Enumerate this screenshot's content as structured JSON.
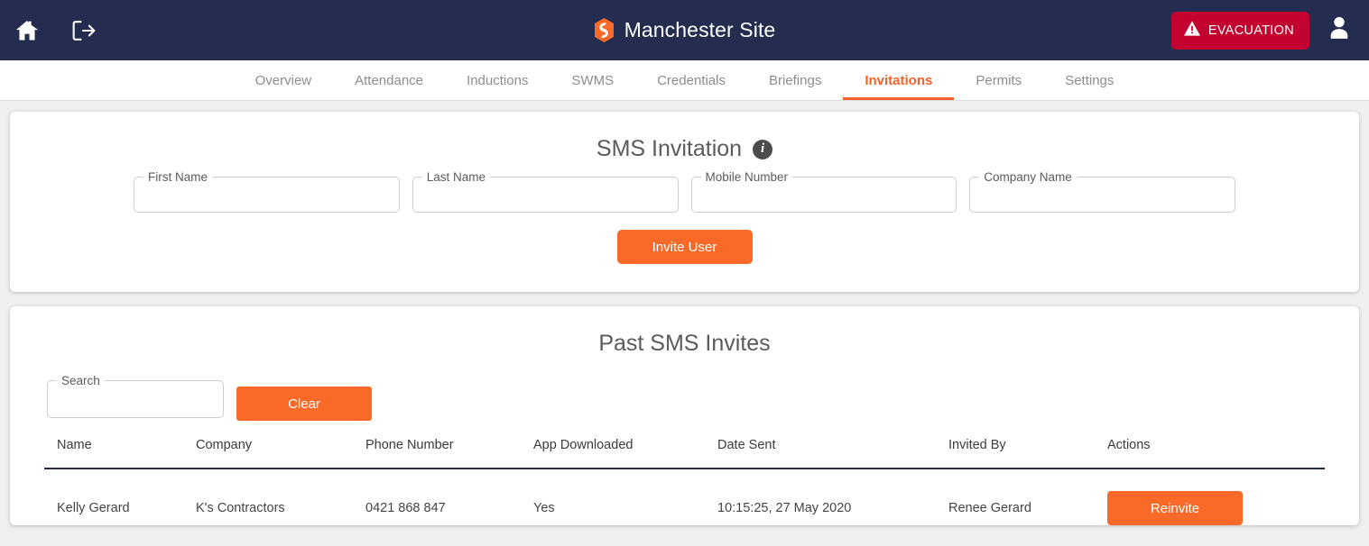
{
  "colors": {
    "navbar": "#242c4f",
    "accent_orange": "#f96a28",
    "evacuation_red": "#c3022f",
    "page_bg": "#efefef"
  },
  "navbar": {
    "home_icon": "home-icon",
    "logout_icon": "logout-icon",
    "logo_icon": "company-logo-icon",
    "title": "Manchester Site",
    "evacuation_label": "EVACUATION",
    "evacuation_icon": "warning-triangle-icon",
    "account_icon": "user-avatar-icon"
  },
  "tabs": [
    {
      "label": "Overview",
      "active": false
    },
    {
      "label": "Attendance",
      "active": false
    },
    {
      "label": "Inductions",
      "active": false
    },
    {
      "label": "SWMS",
      "active": false
    },
    {
      "label": "Credentials",
      "active": false
    },
    {
      "label": "Briefings",
      "active": false
    },
    {
      "label": "Invitations",
      "active": true
    },
    {
      "label": "Permits",
      "active": false
    },
    {
      "label": "Settings",
      "active": false
    }
  ],
  "sms_invitation": {
    "title": "SMS Invitation",
    "info_icon": "info-icon",
    "info_glyph": "i",
    "fields": [
      {
        "label": "First Name",
        "value": "",
        "placeholder": ""
      },
      {
        "label": "Last Name",
        "value": "",
        "placeholder": ""
      },
      {
        "label": "Mobile Number",
        "value": "",
        "placeholder": ""
      },
      {
        "label": "Company Name",
        "value": "",
        "placeholder": ""
      }
    ],
    "invite_button": "Invite User"
  },
  "past_invites": {
    "title": "Past SMS Invites",
    "search_label": "Search",
    "search_value": "",
    "search_placeholder": "",
    "clear_button": "Clear",
    "columns": [
      "Name",
      "Company",
      "Phone Number",
      "App Downloaded",
      "Date Sent",
      "Invited By",
      "Actions"
    ],
    "rows": [
      {
        "name": "Kelly Gerard",
        "company": "K's Contractors",
        "phone": "0421 868 847",
        "app_downloaded": "Yes",
        "date_sent": "10:15:25, 27 May 2020",
        "invited_by": "Renee Gerard",
        "action_label": "Reinvite"
      }
    ]
  }
}
